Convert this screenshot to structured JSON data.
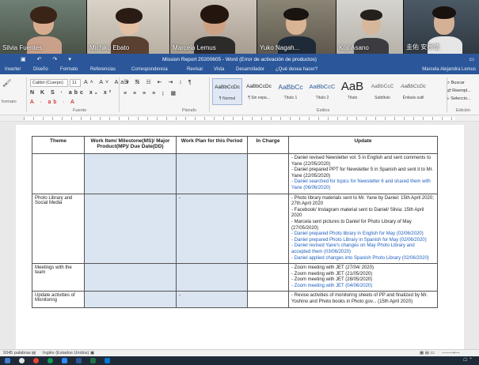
{
  "participants": [
    {
      "name": "Silvia Fuentes"
    },
    {
      "name": "Michiko Ebato"
    },
    {
      "name": "Marcela Lemus"
    },
    {
      "name": "Yuko Nagah..."
    },
    {
      "name": "Koji Asano"
    },
    {
      "name": "圭佑 安根徳"
    }
  ],
  "window": {
    "title": "Mission Report 20200605 - Word (Error de activación de productos)",
    "user": "Marcela Alejandra Lemus"
  },
  "tabs": [
    "Inserter",
    "Diseño",
    "Formato",
    "Referencias",
    "Correspondencia",
    "Revisar",
    "Vista",
    "Desarrollador",
    "¿Qué desea hacer?"
  ],
  "ribbon": {
    "font_name": "Calibri (Cuerpo)",
    "font_size": "11",
    "group_labels": {
      "clipboard": "formato",
      "font": "Fuente",
      "paragraph": "Párrafo",
      "styles": "Estilos",
      "editing": "Edición"
    },
    "styles": [
      {
        "sample": "AaBbCcDc",
        "name": "¶ Normal"
      },
      {
        "sample": "AaBbCcDc",
        "name": "¶ Sin espa..."
      },
      {
        "sample": "AaBbCc",
        "name": "Título 1"
      },
      {
        "sample": "AaBbCcC",
        "name": "Título 2"
      },
      {
        "sample": "AaB",
        "name": "Título"
      },
      {
        "sample": "AaBbCcC",
        "name": "Subtítulo"
      },
      {
        "sample": "AaBbCcDc",
        "name": "Énfasis sutil"
      }
    ],
    "editing": [
      "Buscar",
      "Reempl...",
      "Seleccio..."
    ]
  },
  "table": {
    "headers": [
      "Theme",
      "Work Item/ Milestone(MS)/ Major Product(MP)/ Due Date(DD)",
      "Work Plan for this Period",
      "In Charge",
      "Update"
    ],
    "rows": [
      {
        "theme": "",
        "plan": "",
        "updates": [
          {
            "text": "- Daniel revised Newsletter vol. 5 in English and sent comments to Yane (22/05/2020)",
            "blue": false
          },
          {
            "text": "- Daniel prepared PPT for Newsletter 5 in Spanish and sent it to Mr. Yane (22/05/2020)",
            "blue": false
          },
          {
            "text": "- Daniel searched for topics for Newsletter 6 and shared them with Yane (06/06/2020)",
            "blue": true
          }
        ]
      },
      {
        "theme": "Photo Library and Social Media",
        "plan": "-",
        "updates": [
          {
            "text": "- Photo library materials sent to Mr. Yane by Daniel: 15th April 2020; 27th April 2020",
            "blue": false
          },
          {
            "text": "- Facebook/ Instagram material sent to Daniel/ Silvia: 15th April 2020",
            "blue": false
          },
          {
            "text": "- Marcela sent pictures to Daniel for Photo Library of May (27/05/2020)",
            "blue": false
          },
          {
            "text": "- Daniel prepared Photo library in English for May (02/06/2020)",
            "blue": true
          },
          {
            "text": "- Daniel prepared Photo Library in Spanish for May (02/06/2020)",
            "blue": true
          },
          {
            "text": "- Daniel revised Yane's changes on May Photo Library and accepted them (03/06/2020)",
            "blue": true
          },
          {
            "text": "- Daniel applied changes into Spanish Photo Library (02/06/2020)",
            "blue": true
          }
        ]
      },
      {
        "theme": "Meetings with the team",
        "plan": "",
        "updates": [
          {
            "text": "- Zoom meeting with JET (27/04/ 2020)",
            "blue": false
          },
          {
            "text": "- Zoom meeting with JET (21/05/2020)",
            "blue": false
          },
          {
            "text": "- Zoom meeting with JET (28/05/2020)",
            "blue": false
          },
          {
            "text": "- Zoom meeting with JET (04/06/2020)",
            "blue": true
          }
        ]
      },
      {
        "theme": "Update activities of Monitoring",
        "plan": "-",
        "updates": [
          {
            "text": "- Revise activities of monitoring sheets of PP and finalized by Mr. Yoshino and Photo books in Photo gov... (15th April 2020)",
            "blue": false
          }
        ]
      }
    ]
  },
  "status": {
    "words": "9345 palabras",
    "language": "Inglés (Estados Unidos)"
  }
}
